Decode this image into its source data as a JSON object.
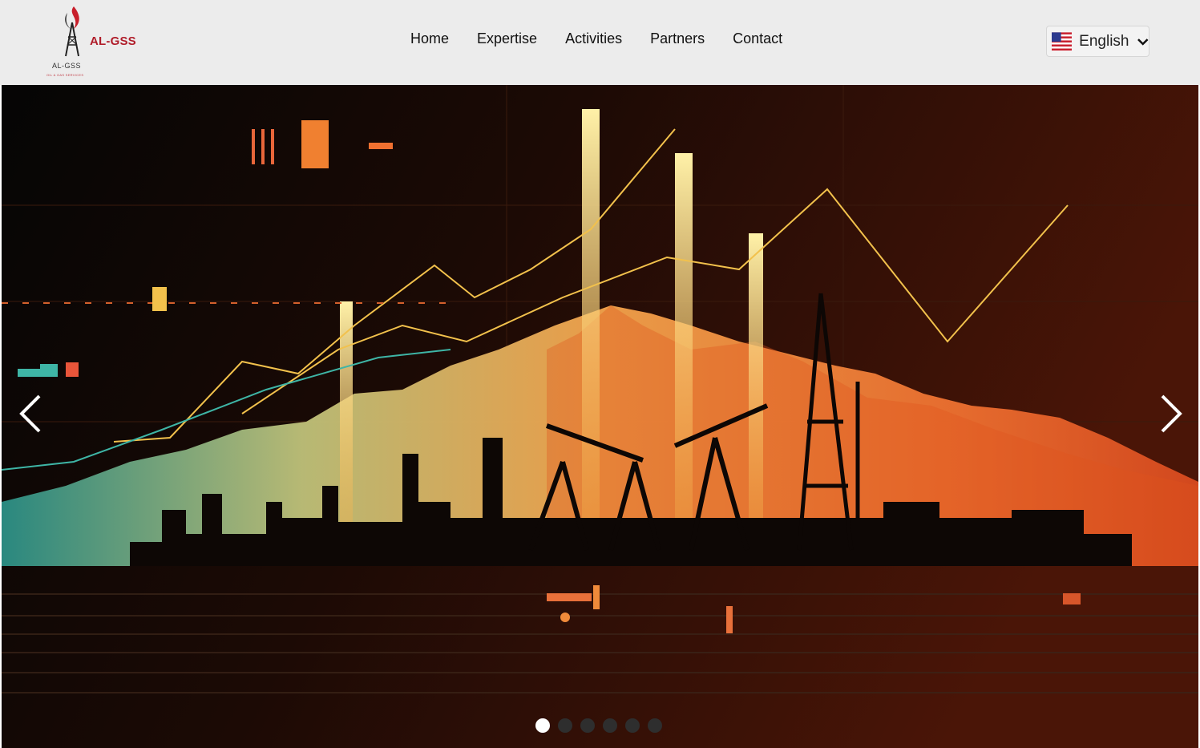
{
  "header": {
    "logo": {
      "brand": "AL-GSS",
      "subtitle": "AL-GSS",
      "tagline": "OIL & GAS SERVICES"
    },
    "nav": [
      {
        "label": "Home"
      },
      {
        "label": "Expertise"
      },
      {
        "label": "Activities"
      },
      {
        "label": "Partners"
      },
      {
        "label": "Contact"
      }
    ],
    "language": {
      "label": "English",
      "flag": "us-flag-icon"
    }
  },
  "hero": {
    "image": "oil-industry-chart-illustration",
    "prev_icon": "chevron-left-icon",
    "next_icon": "chevron-right-icon",
    "slides": {
      "count": 6,
      "active": 1
    }
  },
  "colors": {
    "header_bg": "#ececec",
    "brand_red": "#b01d2a",
    "nav_text": "#111111",
    "hero_orange": "#f07a2a",
    "hero_teal": "#3aa59a"
  }
}
